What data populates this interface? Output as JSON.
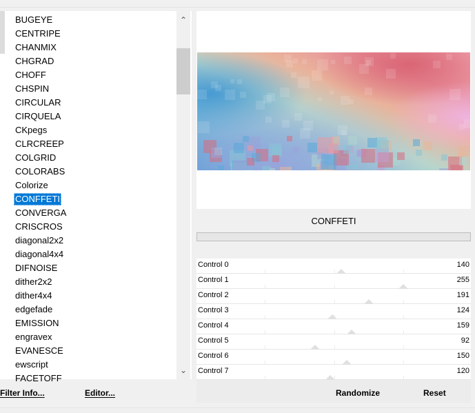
{
  "filters": {
    "items": [
      "BUGEYE",
      "CENTRIPE",
      "CHANMIX",
      "CHGRAD",
      "CHOFF",
      "CHSPIN",
      "CIRCULAR",
      "CIRQUELA",
      "CKpegs",
      "CLRCREEP",
      "COLGRID",
      "COLORABS",
      "Colorize",
      "CONFFETI",
      "CONVERGA",
      "CRISCROS",
      "diagonal2x2",
      "diagonal4x4",
      "DIFNOISE",
      "dither2x2",
      "dither4x4",
      "edgefade",
      "EMISSION",
      "engravex",
      "EVANESCE",
      "ewscript",
      "FACETOFF"
    ],
    "selected": "CONFFETI",
    "scroll": {
      "up_icon": "chevron-up-icon",
      "down_icon": "chevron-down-icon"
    }
  },
  "buttons": {
    "filter_info": "Filter Info...",
    "editor": "Editor...",
    "randomize": "Randomize",
    "reset": "Reset"
  },
  "current_filter": "CONFFETI",
  "progress": 0,
  "controls": [
    {
      "label": "Control 0",
      "value": "140",
      "level": 140
    },
    {
      "label": "Control 1",
      "value": "255",
      "level": 255
    },
    {
      "label": "Control 2",
      "value": "191",
      "level": 191
    },
    {
      "label": "Control 3",
      "value": "124",
      "level": 124
    },
    {
      "label": "Control 4",
      "value": "159",
      "level": 159
    },
    {
      "label": "Control 5",
      "value": "92",
      "level": 92
    },
    {
      "label": "Control 6",
      "value": "150",
      "level": 150
    },
    {
      "label": "Control 7",
      "value": "120",
      "level": 120
    }
  ],
  "colors": {
    "selection": "#0078d7",
    "preview_palette": [
      "#5aaad8",
      "#88c4d6",
      "#aed6cf",
      "#e8b79a",
      "#e89aa2",
      "#d96b7b",
      "#c59ad0",
      "#9aa2d8"
    ]
  }
}
